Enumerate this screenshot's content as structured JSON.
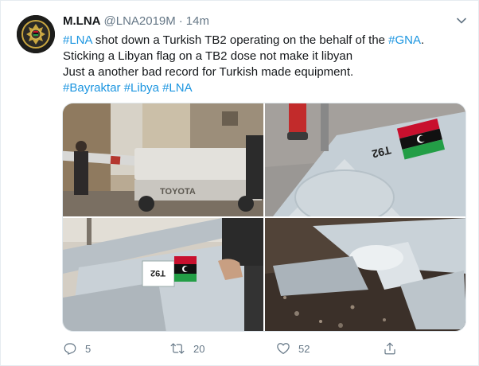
{
  "tweet": {
    "author_name": "M.LNA",
    "author_handle": "@LNA2019M",
    "separator": "·",
    "time": "14m",
    "text_segments": {
      "l1_tag1": "#LNA",
      "l1_mid": " shot down a Turkish TB2 operating on the behalf of the ",
      "l1_tag2": "#GNA",
      "l1_end": ".",
      "l2": "Sticking a Libyan flag on a TB2 dose not make it libyan",
      "l3": "Just a another bad record for Turkish made equipment.",
      "l4_tag1": "#Bayraktar",
      "l4_tag2": "#Libya",
      "l4_tag3": "#LNA"
    },
    "media_labels": {
      "truck_brand": "TOYOTA",
      "tail_code_1": "T92",
      "tail_code_2": "T92"
    },
    "actions": {
      "reply_count": "5",
      "retweet_count": "20",
      "like_count": "52"
    }
  },
  "icons": {
    "avatar": "lna-emblem-avatar",
    "caret": "chevron-down-icon",
    "reply": "reply-icon",
    "retweet": "retweet-icon",
    "like": "heart-icon",
    "share": "share-icon"
  },
  "colors": {
    "link": "#1b95e0",
    "secondary_text": "#657786",
    "primary_text": "#14171a",
    "border": "#e6ecf0"
  }
}
